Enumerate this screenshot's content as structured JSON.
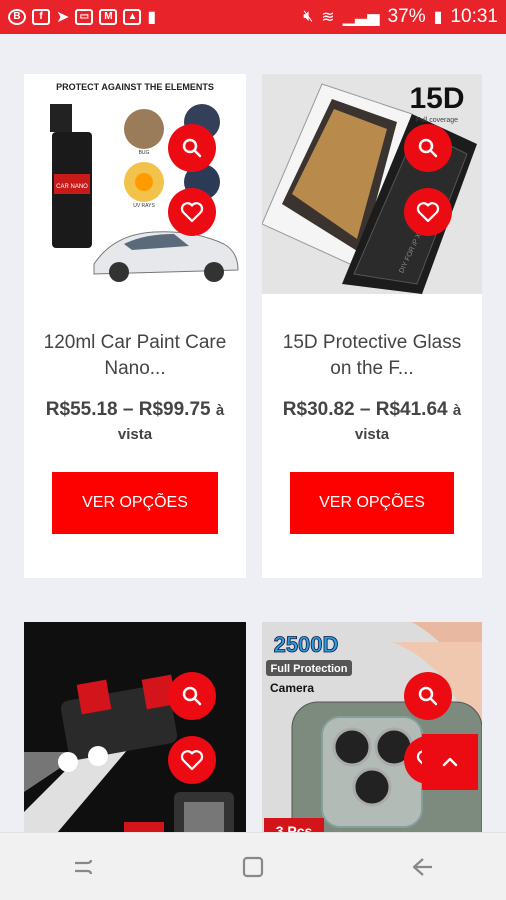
{
  "status_bar": {
    "battery": "37%",
    "time": "10:31"
  },
  "products": [
    {
      "image_caption": "PROTECT AGAINST THE ELEMENTS",
      "bottle_label": "CAR NANO",
      "image_badges": [
        "BUG",
        "UV RAYS"
      ],
      "title": "120ml Car Paint Care Nano...",
      "price_range": "R$55.18 – R$99.75",
      "price_suffix": "à vista",
      "button": "VER OPÇÕES"
    },
    {
      "image_badge": "15D",
      "image_badge_sub": "Full coverage",
      "box_text": "DIY FOR iP X",
      "title": "15D Protective Glass on the F...",
      "price_range": "R$30.82 – R$41.64",
      "price_suffix": "à vista",
      "button": "VER OPÇÕES"
    },
    {
      "title": "",
      "button": ""
    },
    {
      "image_badge": "2500D",
      "image_badge_sub": "Full Protection",
      "image_badge_sub2": "Camera",
      "image_corner": "3 Pcs",
      "title": "",
      "button": ""
    }
  ],
  "icons": {
    "search": "search-icon",
    "favorite": "heart-icon",
    "scroll_top": "chevron-up-icon",
    "nav_recent": "recent-apps-icon",
    "nav_home": "home-icon",
    "nav_back": "back-icon"
  },
  "colors": {
    "accent": "#ec0b12",
    "button": "#fd0000",
    "status_bar": "#e8232a"
  }
}
